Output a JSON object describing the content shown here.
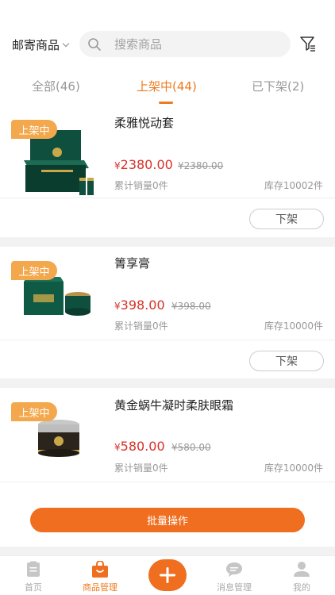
{
  "header": {
    "scope_label": "邮寄商品",
    "search_placeholder": "搜索商品"
  },
  "tabs": [
    {
      "label": "全部(46)",
      "active": false
    },
    {
      "label": "上架中(44)",
      "active": true
    },
    {
      "label": "已下架(2)",
      "active": false
    }
  ],
  "products": [
    {
      "badge": "上架中",
      "name": "柔雅悦动套",
      "currency": "¥",
      "price": "2380.00",
      "original_price": "¥2380.00",
      "sold": "累计销量0件",
      "stock": "库存10002件",
      "action": "下架"
    },
    {
      "badge": "上架中",
      "name": "箐享膏",
      "currency": "¥",
      "price": "398.00",
      "original_price": "¥398.00",
      "sold": "累计销量0件",
      "stock": "库存10000件",
      "action": "下架"
    },
    {
      "badge": "上架中",
      "name": "黄金蜗牛凝时柔肤眼霜",
      "currency": "¥",
      "price": "580.00",
      "original_price": "¥580.00",
      "sold": "累计销量0件",
      "stock": "库存10000件",
      "action": "下架"
    }
  ],
  "batch_button": "批量操作",
  "bottom_nav": [
    {
      "label": "首页",
      "icon": "home-icon",
      "active": false
    },
    {
      "label": "商品管理",
      "icon": "bag-icon",
      "active": true
    },
    {
      "label": "",
      "icon": "plus-icon",
      "active": false
    },
    {
      "label": "消息管理",
      "icon": "chat-icon",
      "active": false
    },
    {
      "label": "我的",
      "icon": "user-icon",
      "active": false
    }
  ],
  "colors": {
    "accent": "#ef6e1f",
    "badge": "#f4a84d",
    "price": "#d9302a"
  }
}
